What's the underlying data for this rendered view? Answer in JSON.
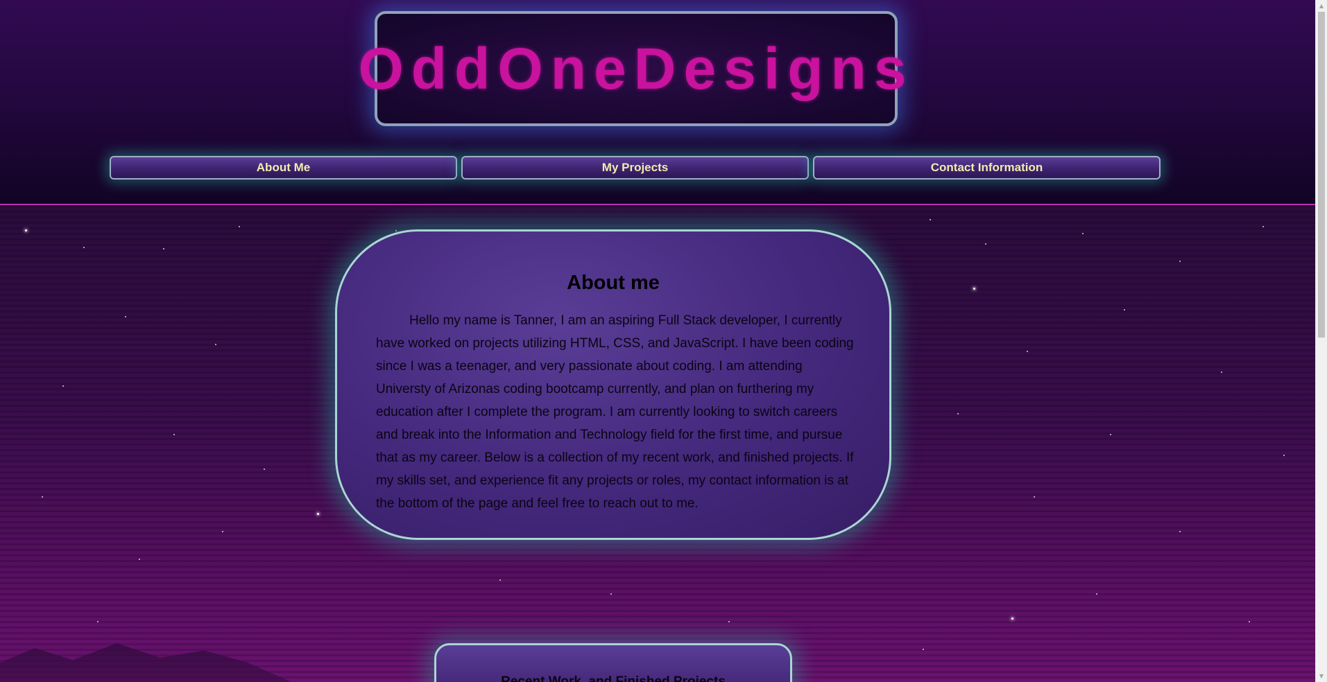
{
  "header": {
    "logo_text": "OddOneDesigns",
    "nav": [
      {
        "label": "About Me"
      },
      {
        "label": "My Projects"
      },
      {
        "label": "Contact Information"
      }
    ]
  },
  "about": {
    "title": "About me",
    "body": "Hello my name is Tanner, I am an aspiring Full Stack developer, I currently have worked on projects utilizing HTML, CSS, and JavaScript. I have been coding since I was a teenager, and very passionate about coding. I am attending Universty of Arizonas coding bootcamp currently, and plan on furthering my education after I complete the program. I am currently looking to switch careers and break into the Information and Technology field for the first time, and pursue that as my career. Below is a collection of my recent work, and finished projects. If my skills set, and experience fit any projects or roles, my contact information is at the bottom of the page and feel free to reach out to me."
  },
  "recent": {
    "title": "Recent Work, and Finished Projects"
  },
  "colors": {
    "logo": "#c9129e",
    "nav_text": "#f2ecac",
    "card_border": "#a9d6d2",
    "card_fill": "#44287c",
    "header_divider": "#c02ab8"
  },
  "icons": {
    "scroll_up": "chevron-up-icon",
    "scroll_down": "chevron-down-icon"
  }
}
